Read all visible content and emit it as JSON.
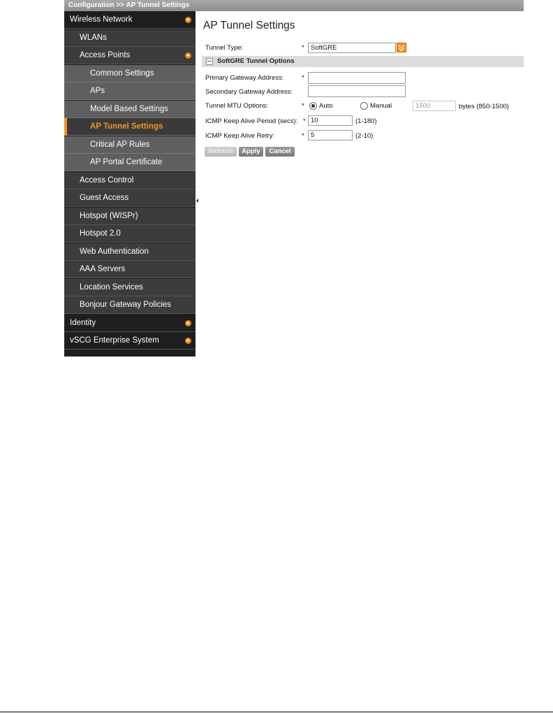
{
  "breadcrumb": "Configuration  >>  AP Tunnel Settings",
  "sidebar": {
    "items": [
      {
        "label": "Wireless Network",
        "indicator": "up"
      },
      {
        "label": "WLANs"
      },
      {
        "label": "Access Points",
        "indicator": "up"
      },
      {
        "label": "Common Settings"
      },
      {
        "label": "APs"
      },
      {
        "label": "Model Based Settings"
      },
      {
        "label": "AP Tunnel Settings"
      },
      {
        "label": "Critical AP Rules"
      },
      {
        "label": "AP Portal Certificate"
      },
      {
        "label": "Access Control"
      },
      {
        "label": "Guest Access"
      },
      {
        "label": "Hotspot (WISPr)"
      },
      {
        "label": "Hotspot 2.0"
      },
      {
        "label": "Web Authentication"
      },
      {
        "label": "AAA Servers"
      },
      {
        "label": "Location Services"
      },
      {
        "label": "Bonjour Gateway Policies"
      },
      {
        "label": "Identity",
        "indicator": "down"
      },
      {
        "label": "vSCG Enterprise System",
        "indicator": "down"
      }
    ]
  },
  "main": {
    "title": "AP Tunnel Settings",
    "required_mark": "*",
    "tunnel_type": {
      "label": "Tunnel Type:",
      "value": "SoftGRE"
    },
    "section": {
      "title": "SoftGRE Tunnel Options"
    },
    "primary_gateway": {
      "label": "Primary Gateway Address:",
      "value": ""
    },
    "secondary_gateway": {
      "label": "Secondary Gateway Address:",
      "value": ""
    },
    "mtu": {
      "label": "Tunnel MTU Options:",
      "auto_label": "Auto",
      "manual_label": "Manual",
      "selected": "Auto",
      "manual_value": "1500",
      "hint": "bytes (850-1500)"
    },
    "keepalive_period": {
      "label": "ICMP Keep Alive Period (secs):",
      "value": "10",
      "hint": "(1-180)"
    },
    "keepalive_retry": {
      "label": "ICMP Keep Alive Retry:",
      "value": "5",
      "hint": "(2-10)"
    },
    "buttons": {
      "refresh": "Refresh",
      "apply": "Apply",
      "cancel": "Cancel"
    }
  },
  "colors": {
    "accent": "#f7941d",
    "sidebar_bg": "#1e1e1e"
  }
}
